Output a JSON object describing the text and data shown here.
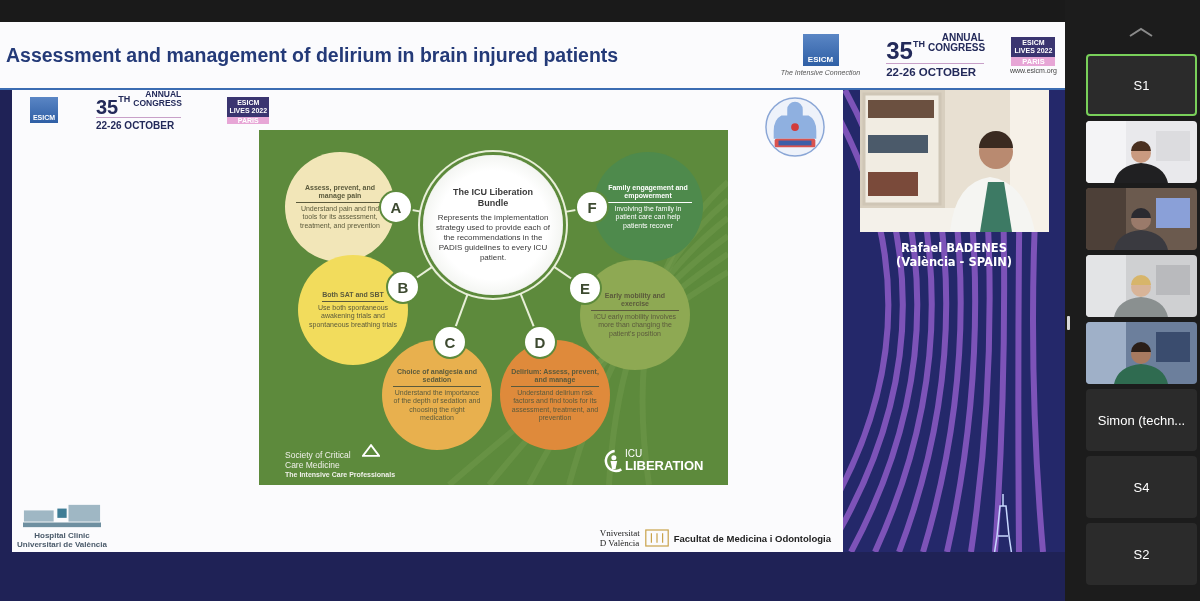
{
  "slide": {
    "title": "Assessment and management of delirium in brain injured patients",
    "header_logos": {
      "esicm": "ESICM",
      "esicm_tagline": "The Intensive Connection",
      "congress_number": "35$^{TH}$",
      "congress_title": "ANNUAL CONGRESS",
      "congress_dates": "22-26 OCTOBER",
      "lives": "ESICM LIVES 2022",
      "lives_city": "PARIS",
      "website": "www.esicm.org"
    },
    "content_logos": {
      "esicm": "ESICM",
      "congress_number": "35$^{TH}$",
      "congress_title": "ANNUAL CONGRESS",
      "congress_dates": "22-26 OCTOBER",
      "lives": "ESICM LIVES 2022",
      "lives_city": "PARIS"
    },
    "diagram": {
      "title": "The ICU Liberation Bundle",
      "description": "Represents the implementation strategy used to provide each of the recommendations in the PADIS guidelines to every ICU patient.",
      "elements": [
        {
          "letter": "A",
          "heading": "Assess, prevent, and manage pain",
          "text": "Understand pain and find tools for its assessment, treatment, and prevention",
          "color": "#f2e6b8"
        },
        {
          "letter": "F",
          "heading": "Family engagement and empowerment",
          "text": "Involving the family in patient care can help patients recover",
          "color": "#4e8a4c"
        },
        {
          "letter": "B",
          "heading": "Both SAT and SBT",
          "text": "Use both spontaneous awakening trials and spontaneous breathing trials",
          "color": "#f2dc5c"
        },
        {
          "letter": "E",
          "heading": "Early mobility and exercise",
          "text": "ICU early mobility involves more than changing the patient's position",
          "color": "#8ea953"
        },
        {
          "letter": "C",
          "heading": "Choice of analgesia and sedation",
          "text": "Understand the importance of the depth of sedation and choosing the right medication",
          "color": "#e8b04e"
        },
        {
          "letter": "D",
          "heading": "Delirium: Assess, prevent, and manage",
          "text": "Understand delirium risk factors and find tools for its assessment, treatment, and prevention",
          "color": "#df8a3b"
        }
      ],
      "sccm": {
        "name": "Society of Critical Care Medicine",
        "tagline": "The Intensive Care Professionals"
      },
      "liberation": {
        "top": "ICU",
        "bottom": "LIBERATION"
      }
    },
    "footer": {
      "hospital": "Hospital Clinic",
      "hospital_sub": "Universitari de València",
      "university": "Vniversitat",
      "university_sub": "D València",
      "faculty": "Facultat de Medicina i Odontologia"
    }
  },
  "speaker": {
    "name": "Rafael BADENES",
    "location": "(València - SPAIN)"
  },
  "participants": [
    {
      "kind": "name",
      "label": "S1",
      "active": true
    },
    {
      "kind": "video",
      "active": false
    },
    {
      "kind": "video",
      "active": false
    },
    {
      "kind": "video",
      "active": false
    },
    {
      "kind": "video",
      "active": false
    },
    {
      "kind": "name",
      "label": "Simon (techn...",
      "active": false
    },
    {
      "kind": "name",
      "label": "S4",
      "active": false
    },
    {
      "kind": "name",
      "label": "S2",
      "active": false
    }
  ]
}
